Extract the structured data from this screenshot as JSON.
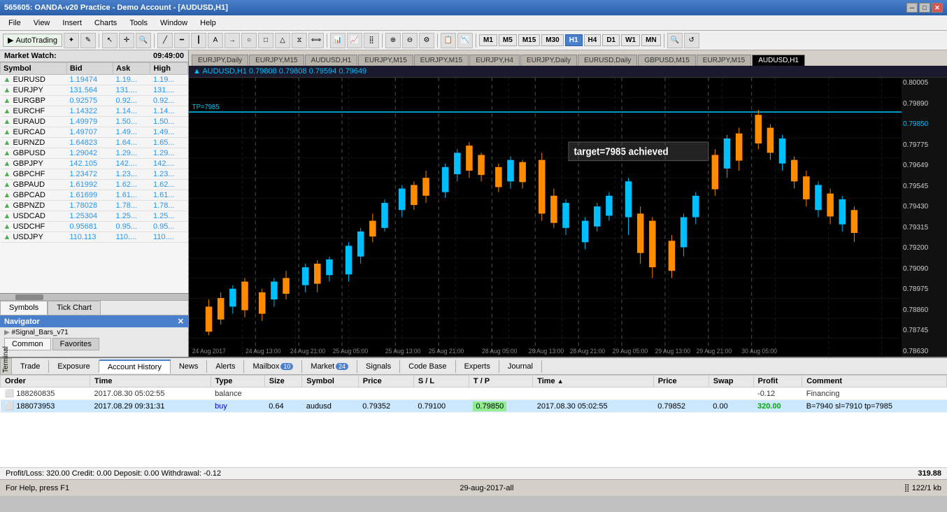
{
  "titlebar": {
    "title": "565605: OANDA-v20 Practice - Demo Account - [AUDUSD,H1]",
    "controls": [
      "minimize",
      "restore",
      "close"
    ]
  },
  "menubar": {
    "items": [
      "File",
      "View",
      "Insert",
      "Charts",
      "Tools",
      "Window",
      "Help"
    ]
  },
  "toolbar": {
    "autotrading_label": "AutoTrading",
    "timeframes": [
      "M1",
      "M5",
      "M15",
      "M30",
      "H1",
      "H4",
      "D1",
      "W1",
      "MN"
    ],
    "active_timeframe": "H1"
  },
  "market_watch": {
    "title": "Market Watch",
    "time": "09:49:00",
    "columns": [
      "Symbol",
      "Bid",
      "Ask",
      "High"
    ],
    "symbols": [
      {
        "symbol": "EURUSD",
        "bid": "1.19474",
        "ask": "1.19...",
        "high": "1.19..."
      },
      {
        "symbol": "EURJPY",
        "bid": "131.564",
        "ask": "131....",
        "high": "131...."
      },
      {
        "symbol": "EURGBP",
        "bid": "0.92575",
        "ask": "0.92...",
        "high": "0.92..."
      },
      {
        "symbol": "EURCHF",
        "bid": "1.14322",
        "ask": "1.14...",
        "high": "1.14..."
      },
      {
        "symbol": "EURAUD",
        "bid": "1.49979",
        "ask": "1.50...",
        "high": "1.50..."
      },
      {
        "symbol": "EURCAD",
        "bid": "1.49707",
        "ask": "1.49...",
        "high": "1.49..."
      },
      {
        "symbol": "EURNZD",
        "bid": "1.64823",
        "ask": "1.64...",
        "high": "1.65..."
      },
      {
        "symbol": "GBPUSD",
        "bid": "1.29042",
        "ask": "1.29...",
        "high": "1.29..."
      },
      {
        "symbol": "GBPJPY",
        "bid": "142.105",
        "ask": "142....",
        "high": "142...."
      },
      {
        "symbol": "GBPCHF",
        "bid": "1.23472",
        "ask": "1.23...",
        "high": "1.23..."
      },
      {
        "symbol": "GBPAUD",
        "bid": "1.61992",
        "ask": "1.62...",
        "high": "1.62..."
      },
      {
        "symbol": "GBPCAD",
        "bid": "1.61699",
        "ask": "1.61...",
        "high": "1.61..."
      },
      {
        "symbol": "GBPNZD",
        "bid": "1.78028",
        "ask": "1.78...",
        "high": "1.78..."
      },
      {
        "symbol": "USDCAD",
        "bid": "1.25304",
        "ask": "1.25...",
        "high": "1.25..."
      },
      {
        "symbol": "USDCHF",
        "bid": "0.95681",
        "ask": "0.95...",
        "high": "0.95..."
      },
      {
        "symbol": "USDJPY",
        "bid": "110.113",
        "ask": "110....",
        "high": "110...."
      }
    ],
    "tabs": [
      "Symbols",
      "Tick Chart"
    ]
  },
  "navigator": {
    "title": "Navigator",
    "item": "#Signal_Bars_v71",
    "tabs": [
      "Common",
      "Favorites"
    ]
  },
  "chart": {
    "title": "▲ AUDUSD,H1  0.79808  0.79808  0.79594  0.79649",
    "tp_label": "TP=7985",
    "target_label": "target=7985 achieved",
    "price_levels": [
      "0.80005",
      "0.79890",
      "0.79850",
      "0.79775",
      "0.79649",
      "0.79545",
      "0.79430",
      "0.79315",
      "0.79200",
      "0.79090",
      "0.78975",
      "0.78860",
      "0.78745",
      "0.78630"
    ],
    "time_labels": [
      "24 Aug 2017",
      "24 Aug 13:00",
      "24 Aug 21:00",
      "25 Aug 05:00",
      "25 Aug 13:00",
      "25 Aug 21:00",
      "28 Aug 05:00",
      "28 Aug 13:00",
      "28 Aug 21:00",
      "29 Aug 05:00",
      "29 Aug 13:00",
      "29 Aug 21:00",
      "30 Aug 05:00"
    ]
  },
  "chart_tabs": [
    {
      "label": "EURJPY,Daily",
      "active": false
    },
    {
      "label": "EURJPY,M15",
      "active": false
    },
    {
      "label": "AUDUSD,H1",
      "active": false
    },
    {
      "label": "EURJPY,M15",
      "active": false
    },
    {
      "label": "EURJPY,M15",
      "active": false
    },
    {
      "label": "EURJPY,H4",
      "active": false
    },
    {
      "label": "EURJPY,Daily",
      "active": false
    },
    {
      "label": "EURUSD,Daily",
      "active": false
    },
    {
      "label": "GBPUSD,M15",
      "active": false
    },
    {
      "label": "EURJPY,M15",
      "active": false
    },
    {
      "label": "AUDUSD,H1",
      "active": true
    }
  ],
  "terminal": {
    "tabs": [
      {
        "label": "Trade",
        "active": false
      },
      {
        "label": "Exposure",
        "active": false
      },
      {
        "label": "Account History",
        "active": true
      },
      {
        "label": "News",
        "active": false
      },
      {
        "label": "Alerts",
        "active": false
      },
      {
        "label": "Mailbox",
        "badge": "10",
        "active": false
      },
      {
        "label": "Market",
        "badge": "24",
        "active": false
      },
      {
        "label": "Signals",
        "active": false
      },
      {
        "label": "Code Base",
        "active": false
      },
      {
        "label": "Experts",
        "active": false
      },
      {
        "label": "Journal",
        "active": false
      }
    ],
    "table": {
      "columns": [
        "Order",
        "Time",
        "Type",
        "Size",
        "Symbol",
        "Price",
        "S / L",
        "T / P",
        "Time",
        "Price",
        "Swap",
        "Profit",
        "Comment"
      ],
      "rows": [
        {
          "type": "balance",
          "order": "188260835",
          "time": "2017.08.30 05:02:55",
          "row_type": "balance",
          "type_label": "balance",
          "size": "",
          "symbol": "",
          "price": "",
          "sl": "",
          "tp": "",
          "time2": "",
          "price2": "",
          "swap": "",
          "profit": "-0.12",
          "comment": "Financing"
        },
        {
          "type": "trade",
          "order": "188073953",
          "time": "2017.08.29 09:31:31",
          "row_type": "buy",
          "type_label": "buy",
          "size": "0.64",
          "symbol": "audusd",
          "price": "0.79352",
          "sl": "0.79100",
          "tp": "0.79850",
          "time2": "2017.08.30 05:02:55",
          "price2": "0.79852",
          "swap": "0.00",
          "profit": "320.00",
          "comment": "B=7940 sl=7910 tp=7985"
        }
      ]
    },
    "summary": {
      "text": "Profit/Loss: 320.00  Credit: 0.00  Deposit: 0.00  Withdrawal: -0.12",
      "total": "319.88"
    }
  },
  "statusbar": {
    "help": "For Help, press F1",
    "date": "29-aug-2017-all",
    "memory": "122/1 kb"
  }
}
